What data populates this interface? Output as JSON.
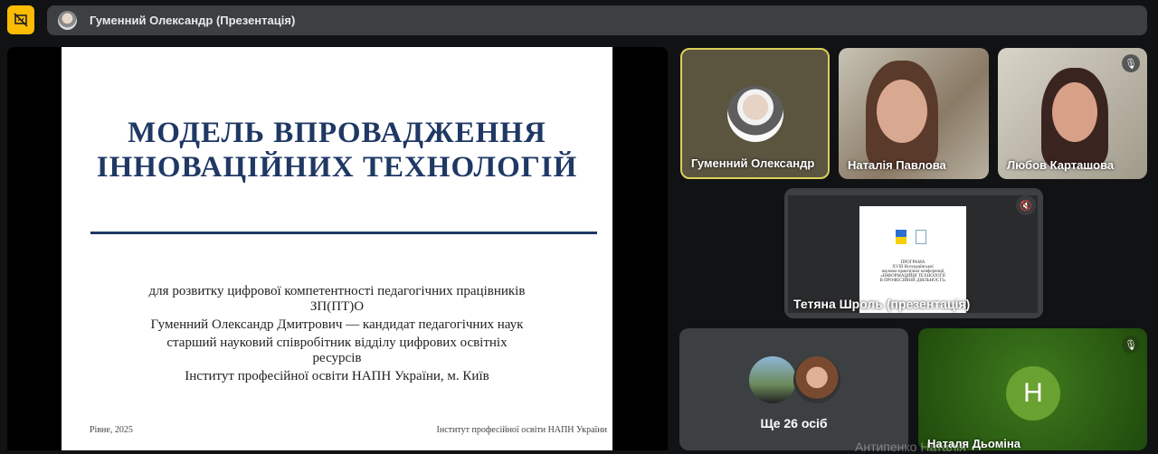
{
  "topbar": {
    "title": "Гуменний Олександр (Презентація)"
  },
  "slide": {
    "title_line1": "МОДЕЛЬ ВПРОВАДЖЕННЯ",
    "title_line2": "ІННОВАЦІЙНИХ ТЕХНОЛОГІЙ",
    "lines": [
      "для розвитку цифрової компетентності педагогічних працівників",
      "ЗП(ПТ)О",
      "Гуменний Олександр Дмитрович — кандидат педагогічних наук",
      "старший науковий співробітник відділу цифрових освітніх",
      "ресурсів",
      "Інститут професійної освіти НАПН України, м. Київ"
    ],
    "footer_left": "Рівне, 2025",
    "footer_right": "Інститут професійної освіти НАПН України"
  },
  "participants": [
    {
      "name": "Гуменний Олександр"
    },
    {
      "name": "Наталія Павлова"
    },
    {
      "name": "Любов Карташова"
    },
    {
      "name": "Тетяна Шроль (презентація)"
    },
    {
      "name": "Ще 26 осіб"
    },
    {
      "name": "Наталя Дьоміна",
      "initial": "Н"
    }
  ],
  "shared_doc": {
    "lines": [
      "ПРОГРАМА",
      "XVIII Всеукраїнської",
      "науково-практичної конференції",
      "«ІНФОРМАЦІЙНІ ТЕХНОЛОГІЇ",
      "В ПРОФЕСІЙНІЙ ДІЯЛЬНОСТІ»"
    ]
  },
  "caption": "Антипенко Наталія",
  "colors": {
    "accent": "#fbbc04",
    "avatar_green": "#6aa232"
  }
}
